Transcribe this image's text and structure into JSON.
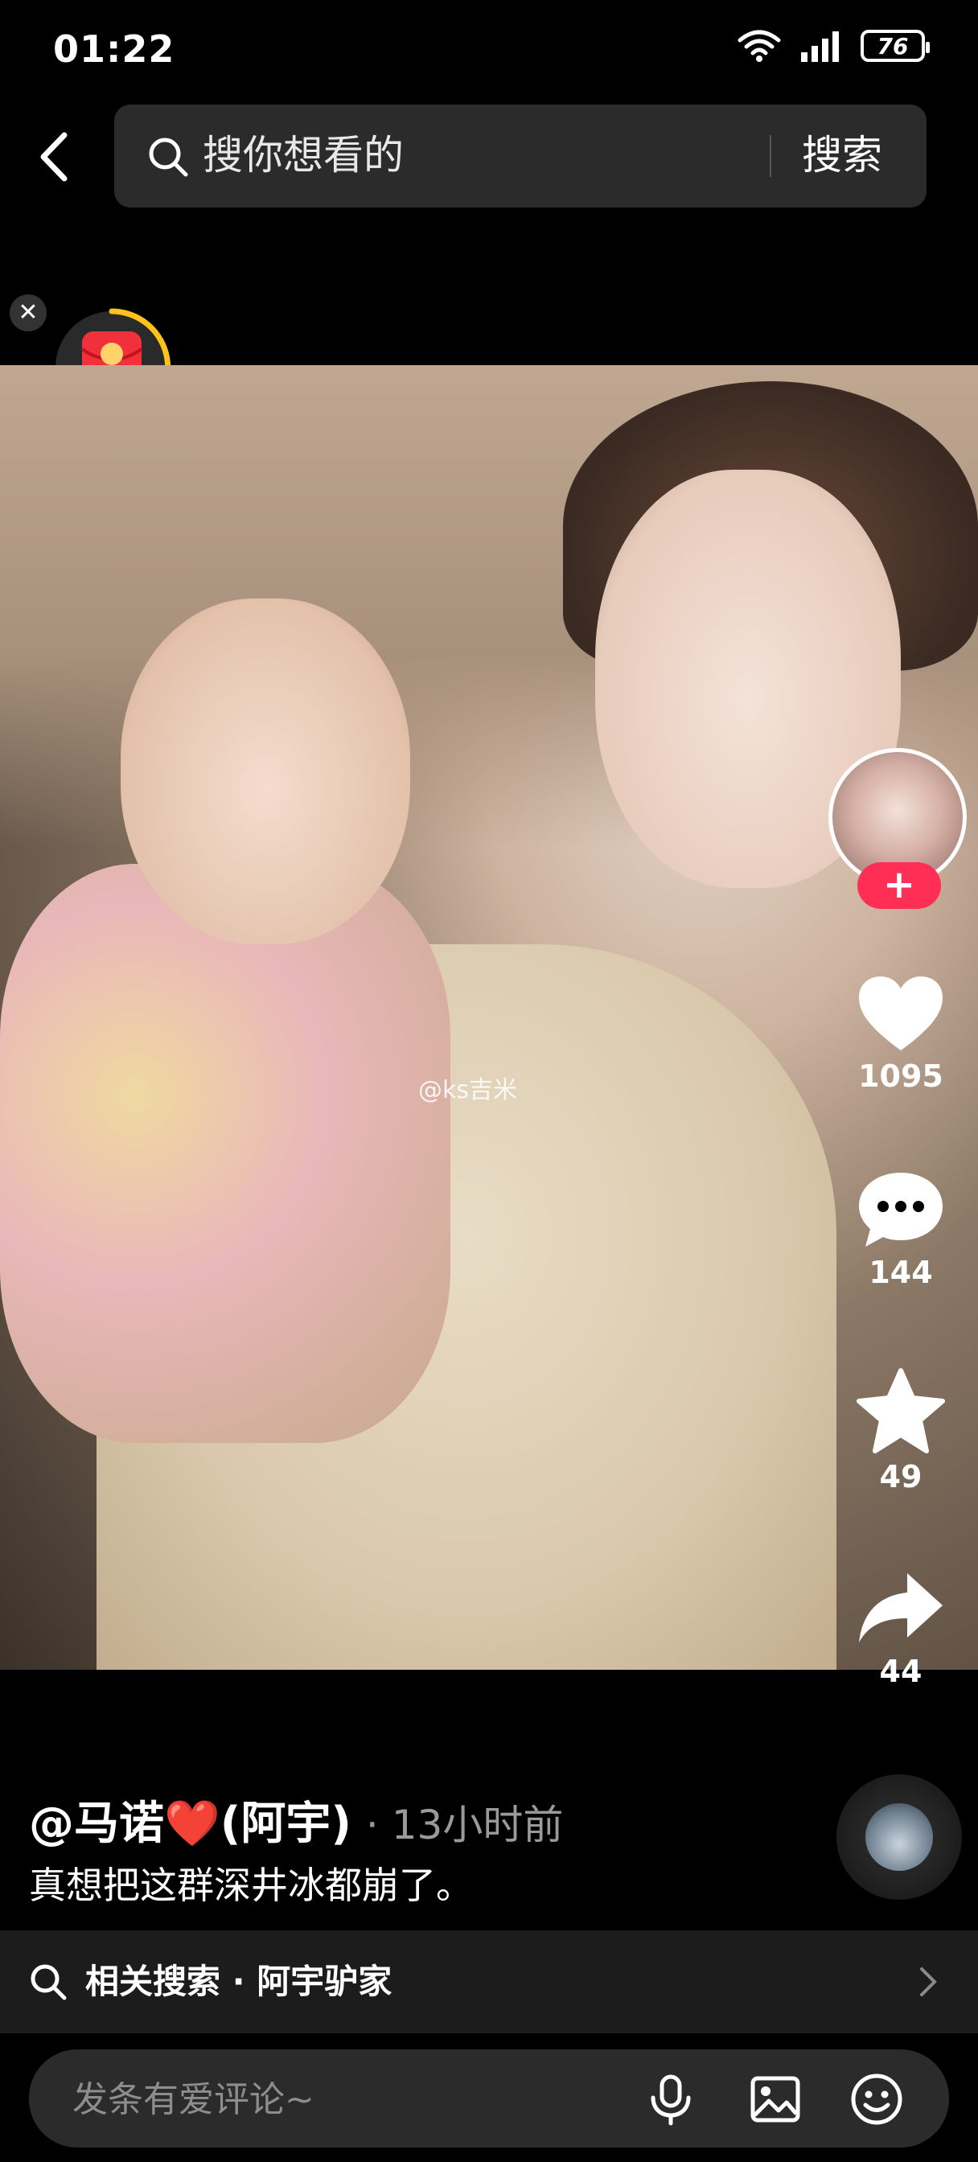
{
  "status_bar": {
    "time": "01:22",
    "battery": "76"
  },
  "search": {
    "placeholder": "搜你想看的",
    "submit_label": "搜索"
  },
  "photo": {
    "watermark": "@ks吉米"
  },
  "actions": {
    "likes": "1095",
    "comments": "144",
    "favorites": "49",
    "shares": "44"
  },
  "post": {
    "author": "@马诺❤️(阿宇)",
    "time": "· 13小时前",
    "caption": "真想把这群深井冰都崩了。"
  },
  "related_search": {
    "text": "相关搜索 · 阿宇驴家"
  },
  "comment": {
    "placeholder": "发条有爱评论~"
  },
  "colors": {
    "accent_red": "#ff2e55",
    "background": "#000000"
  },
  "icons": [
    "back-icon",
    "search-icon",
    "close-icon",
    "red-packet-icon",
    "plus-icon",
    "heart-icon",
    "comment-icon",
    "star-icon",
    "share-icon",
    "chevron-right-icon",
    "microphone-icon",
    "image-icon",
    "emoji-icon",
    "wifi-icon",
    "signal-icon",
    "battery-icon"
  ]
}
